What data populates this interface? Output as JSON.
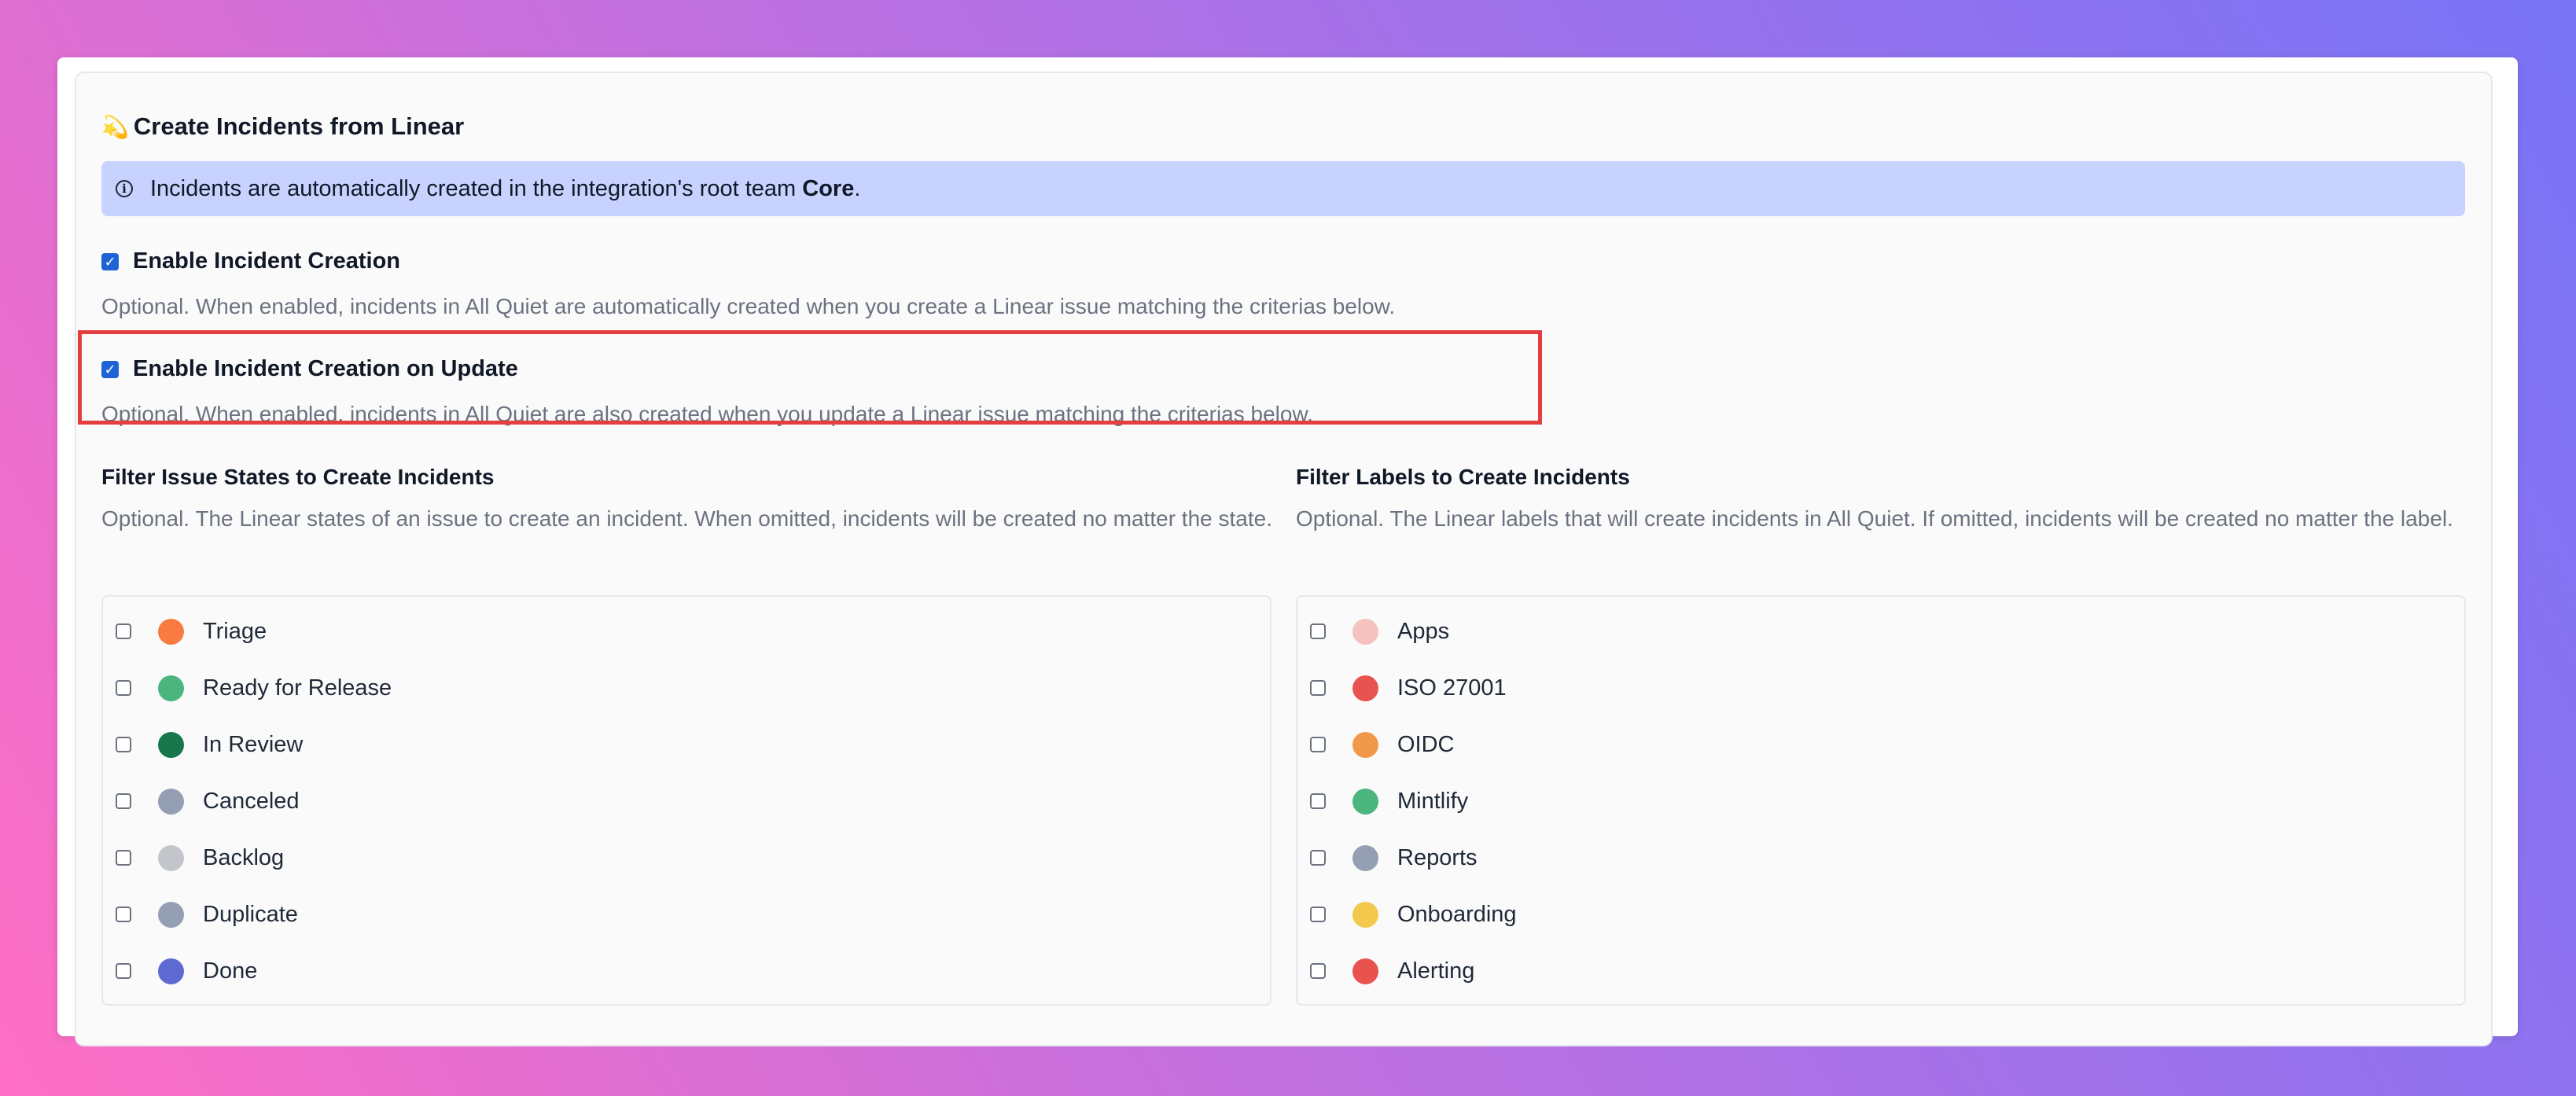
{
  "section": {
    "emoji": "💫",
    "title": "Create Incidents from Linear"
  },
  "info": {
    "text_before": "Incidents are automatically created in the integration's root team ",
    "team": "Core",
    "text_after": "."
  },
  "options": {
    "creation": {
      "label": "Enable Incident Creation",
      "checked": true,
      "help": "Optional. When enabled, incidents in All Quiet are automatically created when you create a Linear issue matching the criterias below."
    },
    "update": {
      "label": "Enable Incident Creation on Update",
      "checked": true,
      "help": "Optional. When enabled, incidents in All Quiet are also created when you update a Linear issue matching the criterias below."
    }
  },
  "states": {
    "title": "Filter Issue States to Create Incidents",
    "help": "Optional. The Linear states of an issue to create an incident. When omitted, incidents will be created no matter the state.",
    "items": [
      {
        "label": "Triage",
        "color": "#f97b42",
        "checked": false
      },
      {
        "label": "Ready for Release",
        "color": "#4bb57e",
        "checked": false
      },
      {
        "label": "In Review",
        "color": "#16774a",
        "checked": false
      },
      {
        "label": "Canceled",
        "color": "#959fb3",
        "checked": false
      },
      {
        "label": "Backlog",
        "color": "#c2c5c9",
        "checked": false
      },
      {
        "label": "Duplicate",
        "color": "#959fb3",
        "checked": false
      },
      {
        "label": "Done",
        "color": "#5e6ad2",
        "checked": false
      }
    ]
  },
  "labels": {
    "title": "Filter Labels to Create Incidents",
    "help": "Optional. The Linear labels that will create incidents in All Quiet. If omitted, incidents will be created no matter the label.",
    "items": [
      {
        "label": "Apps",
        "color": "#f5c2bd",
        "checked": false
      },
      {
        "label": "ISO 27001",
        "color": "#e8524f",
        "checked": false
      },
      {
        "label": "OIDC",
        "color": "#f0994a",
        "checked": false
      },
      {
        "label": "Mintlify",
        "color": "#4bb57e",
        "checked": false
      },
      {
        "label": "Reports",
        "color": "#959fb3",
        "checked": false
      },
      {
        "label": "Onboarding",
        "color": "#f2c94c",
        "checked": false
      },
      {
        "label": "Alerting",
        "color": "#e8524f",
        "checked": false
      }
    ]
  }
}
